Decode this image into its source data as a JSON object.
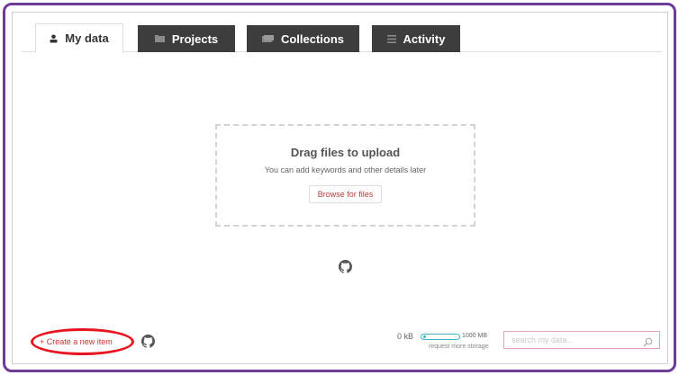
{
  "tabs": [
    {
      "label": "My data",
      "icon": "user-icon",
      "active": true
    },
    {
      "label": "Projects",
      "icon": "folder-icon",
      "active": false
    },
    {
      "label": "Collections",
      "icon": "collection-icon",
      "active": false
    },
    {
      "label": "Activity",
      "icon": "list-icon",
      "active": false
    }
  ],
  "upload": {
    "title": "Drag files to upload",
    "subtitle": "You can add keywords and other details later",
    "browse_label": "Browse for files"
  },
  "footer": {
    "create_label": "+ Create a new item",
    "storage_used": "0 kB",
    "storage_max": "1000 MB",
    "storage_fraction": 0.0,
    "request_storage_label": "request more storage",
    "search_placeholder": "search my data..."
  },
  "annotation": {
    "color": "#e8141e",
    "target": "create-new-item-link"
  },
  "colors": {
    "frame_border": "#6f3a98",
    "tab_dark": "#3d3d3d",
    "link_red": "#cc3333",
    "storage_accent": "#37b5c6",
    "search_border": "#e7a3b2"
  }
}
